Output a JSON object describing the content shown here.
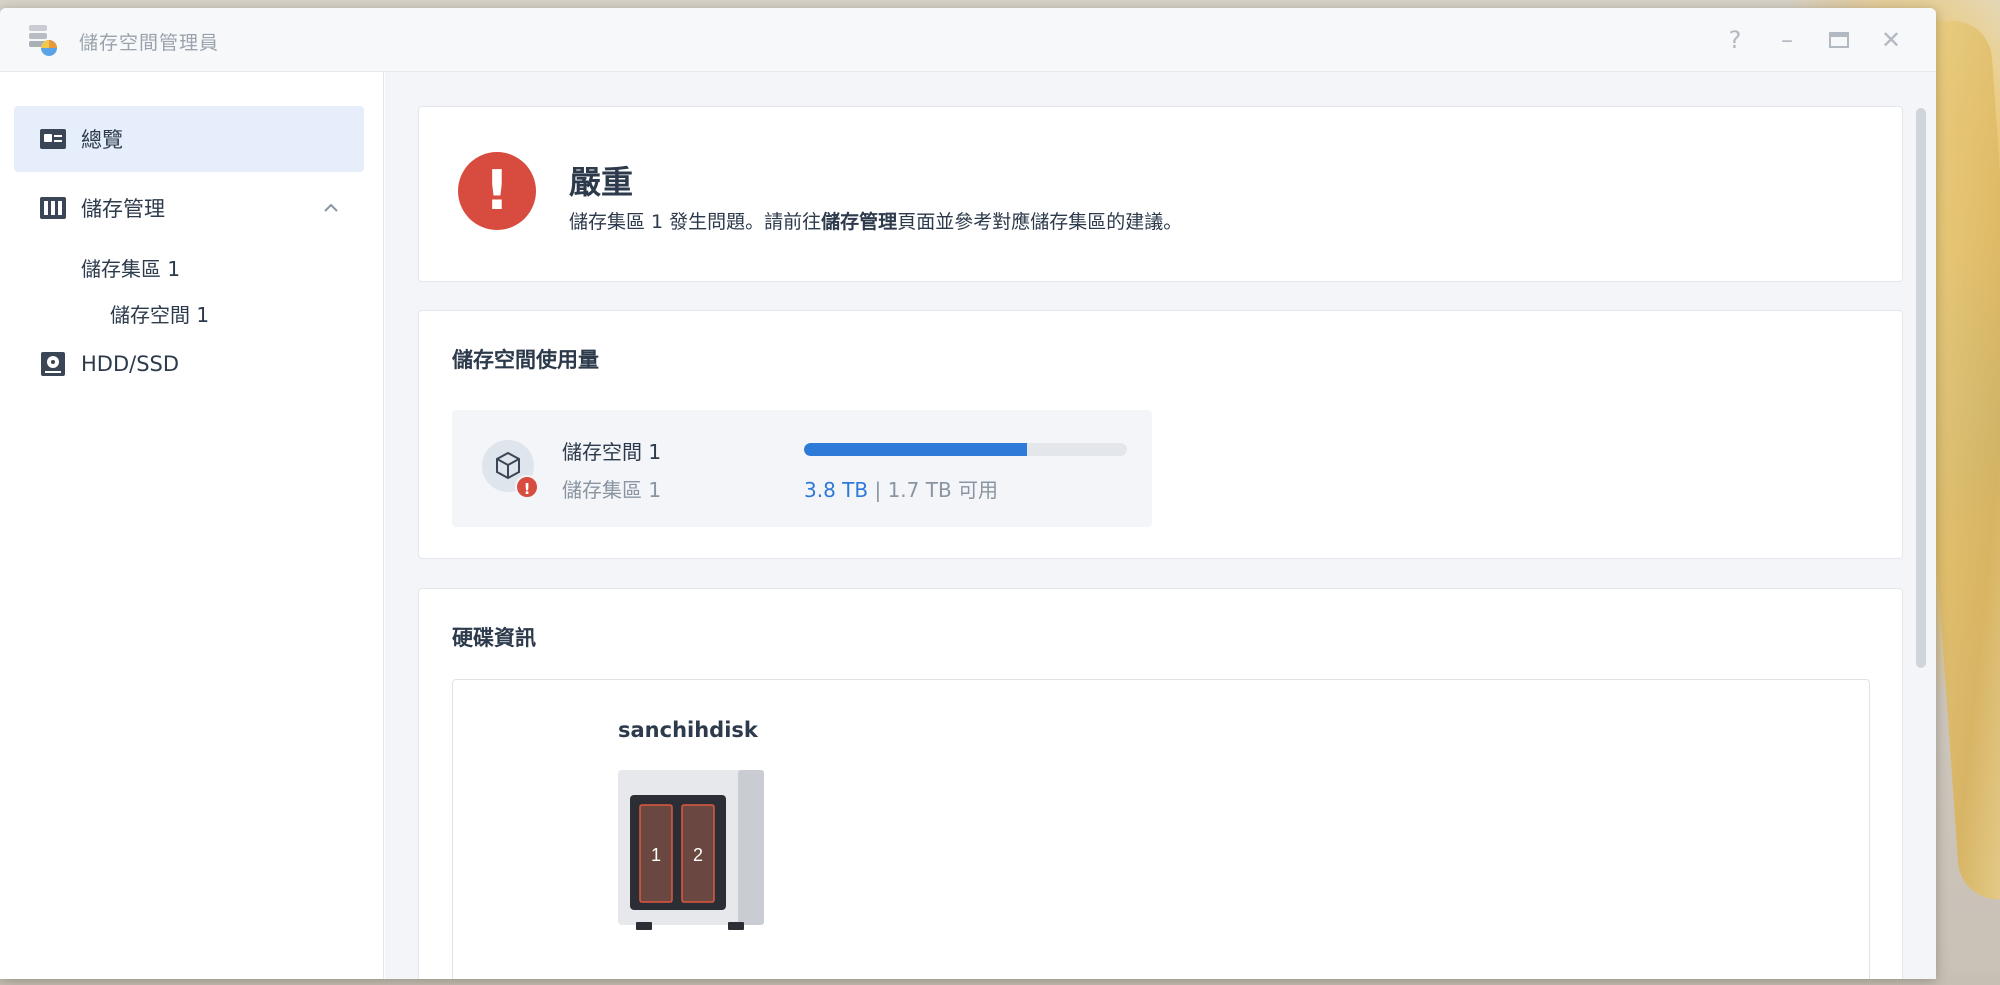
{
  "window": {
    "title": "儲存空間管理員",
    "controls": {
      "help": "?",
      "minimize": "–",
      "maximize": "▭",
      "close": "✕"
    }
  },
  "sidebar": {
    "items": [
      {
        "label": "總覽",
        "icon": "overview-icon",
        "active": true
      },
      {
        "label": "儲存管理",
        "icon": "storage-icon",
        "expanded": true
      },
      {
        "label": "儲存集區 1",
        "level": 1
      },
      {
        "label": "儲存空間 1",
        "level": 2
      },
      {
        "label": "HDD/SSD",
        "icon": "hdd-icon"
      }
    ]
  },
  "alert": {
    "severity": "嚴重",
    "text_before": "儲存集區 1 發生問題。請前往",
    "text_bold": "儲存管理",
    "text_after": "頁面並參考對應儲存集區的建議。",
    "icon": "!"
  },
  "usage": {
    "title": "儲存空間使用量",
    "volume": {
      "name": "儲存空間 1",
      "pool": "儲存集區 1",
      "used": "3.8 TB",
      "separator": "|",
      "available": "1.7 TB 可用",
      "used_fraction": 0.69,
      "warning_icon": "!"
    }
  },
  "hdd": {
    "title": "硬碟資訊",
    "nas_name": "sanchihdisk",
    "bays": [
      "1",
      "2"
    ]
  },
  "colors": {
    "accent": "#2e7ad8",
    "danger": "#d84b3f",
    "text": "#2c3a4b",
    "muted": "#8a95a1"
  }
}
